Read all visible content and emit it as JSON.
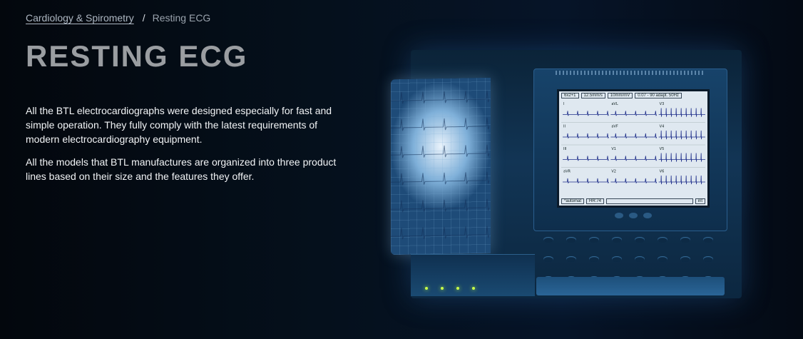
{
  "breadcrumb": {
    "parent_label": "Cardiology & Spirometry",
    "separator": "/",
    "current_label": "Resting ECG"
  },
  "page_title": "RESTING ECG",
  "description": [
    "All the BTL electrocardiographs were designed especially for fast and simple operation. They fully comply with the latest requirements of modern electrocardiography equipment.",
    "All the models that BTL manufactures are organized into three product lines based on their size and the features they offer."
  ],
  "device_screen": {
    "header": [
      "6x2+1",
      "12.5mm/s",
      "10mm/mV",
      "0.07 - 90 adapt. 50Hz"
    ],
    "leads": [
      "I",
      "aVL",
      "V3",
      "II",
      "aVF",
      "V4",
      "III",
      "V1",
      "V5",
      "aVR",
      "V2",
      "V6"
    ],
    "footer": [
      "*automat",
      "HR:74",
      "",
      "int"
    ]
  },
  "colors": {
    "background": "#04080f",
    "title": "#9a9da1",
    "body_text": "#f2f4f6",
    "breadcrumb": "#aeb7c2",
    "led": "#c9ff4a"
  }
}
